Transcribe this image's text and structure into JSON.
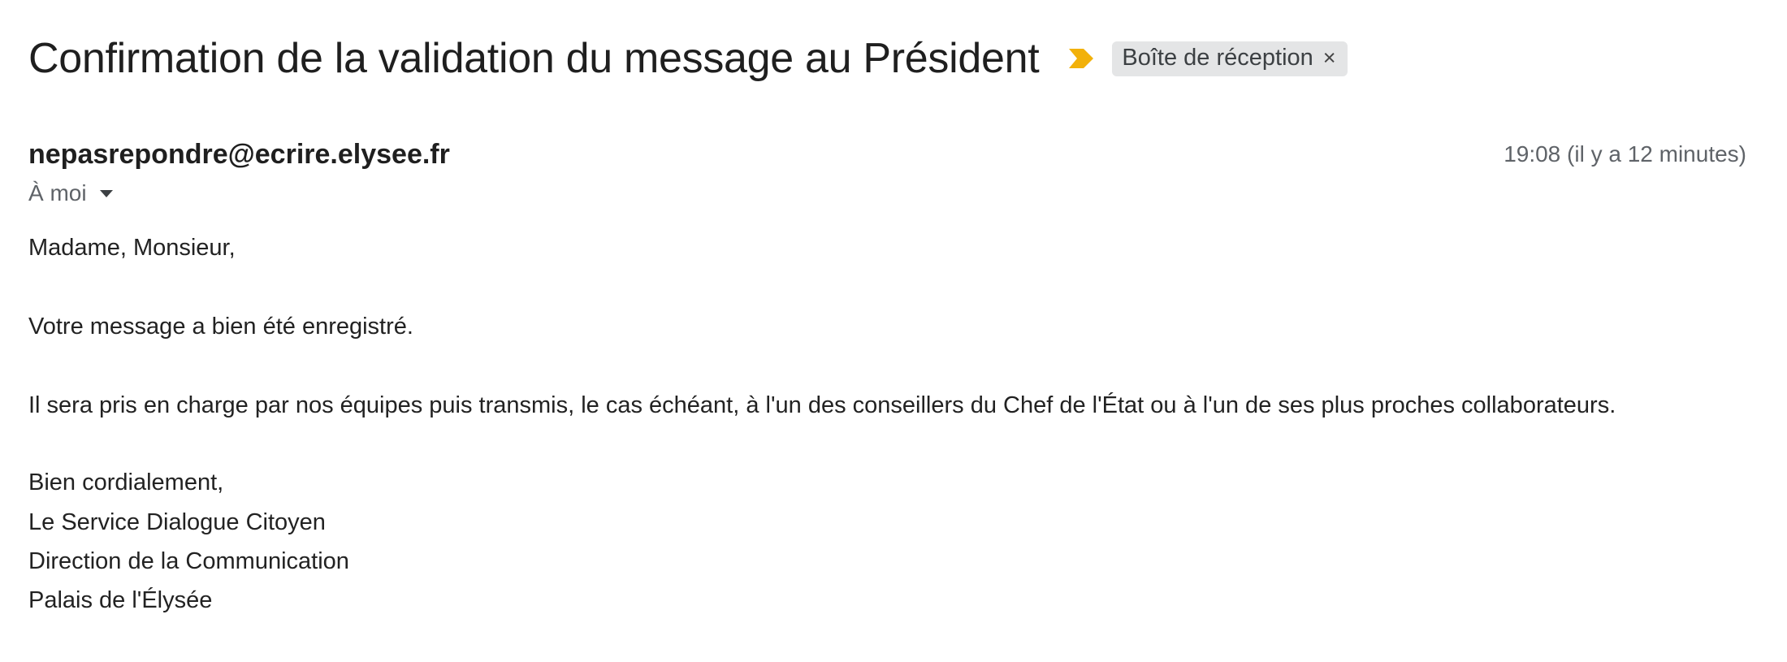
{
  "email": {
    "subject": "Confirmation de la validation du message au Président",
    "importance_icon": "importance-marker-icon",
    "importance_color": "#f2b10a",
    "label": {
      "text": "Boîte de réception",
      "remove_symbol": "×"
    },
    "sender": "nepasrepondre@ecrire.elysee.fr",
    "timestamp": "19:08 (il y a 12 minutes)",
    "recipient": "À moi",
    "body": {
      "greeting": "Madame, Monsieur,",
      "paragraph1": "Votre message a bien été enregistré.",
      "paragraph2": "Il sera pris en charge par nos équipes puis transmis, le cas échéant, à l'un des conseillers du Chef de l'État ou à l'un de ses plus proches collaborateurs.",
      "closing": "Bien cordialement,",
      "signature": [
        "Le Service Dialogue Citoyen",
        "Direction de la Communication",
        "Palais de l'Élysée"
      ]
    }
  }
}
